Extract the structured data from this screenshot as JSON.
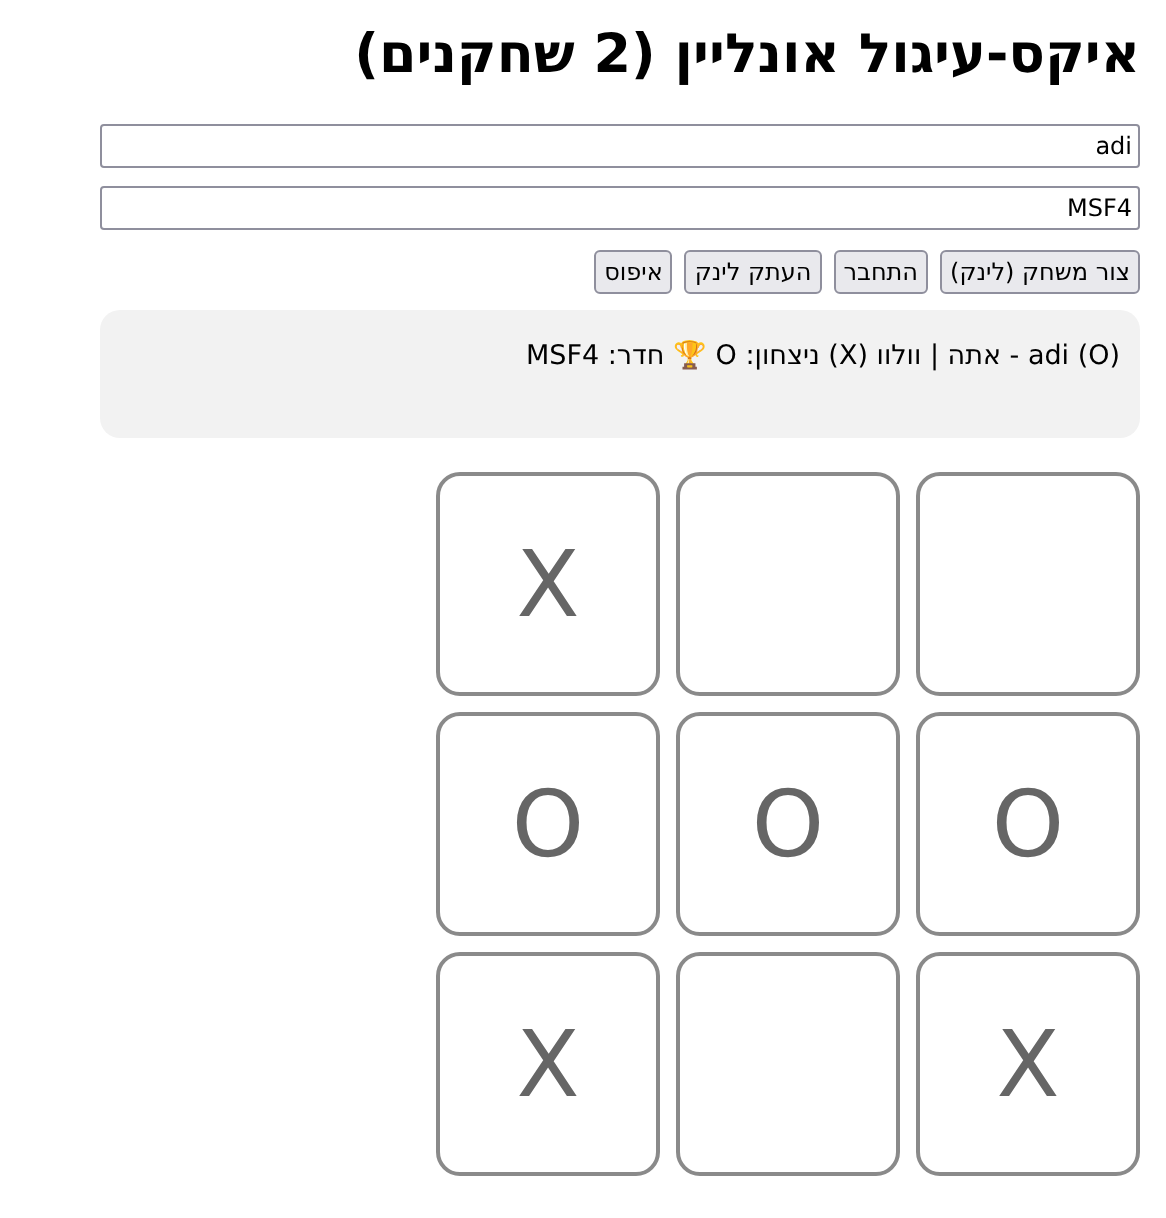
{
  "title": "איקס-עיגול אונליין (2 שחקנים)",
  "fields": [
    {
      "value": "adi"
    },
    {
      "value": "MSF4"
    }
  ],
  "buttons": [
    "צור משחק (לינק)",
    "התחבר",
    "העתק לינק",
    "איפוס"
  ],
  "status": "adi (O) - אתה | וולוו (X) ניצחון: O 🏆 חדר: MSF4",
  "board": [
    {
      "kind": "empty"
    },
    {
      "kind": "empty"
    },
    {
      "kind": "mark",
      "mark": "X"
    },
    {
      "kind": "mark",
      "mark": "O"
    },
    {
      "kind": "mark",
      "mark": "O"
    },
    {
      "kind": "mark",
      "mark": "O"
    },
    {
      "kind": "mark",
      "mark": "X"
    },
    {
      "kind": "empty"
    },
    {
      "kind": "mark",
      "mark": "X"
    }
  ]
}
